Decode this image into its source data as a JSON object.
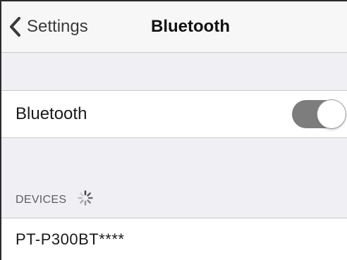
{
  "navbar": {
    "back_label": "Settings",
    "title": "Bluetooth"
  },
  "bluetooth_cell": {
    "label": "Bluetooth",
    "toggle_on": true
  },
  "devices_section": {
    "header": "DEVICES",
    "items": [
      {
        "name": "PT-P300BT****"
      }
    ]
  },
  "colors": {
    "toggle_track": "#7d7d7d",
    "background": "#efeff4"
  },
  "icons": {
    "back": "chevron-left-icon",
    "loading": "loading-spinner-icon"
  }
}
